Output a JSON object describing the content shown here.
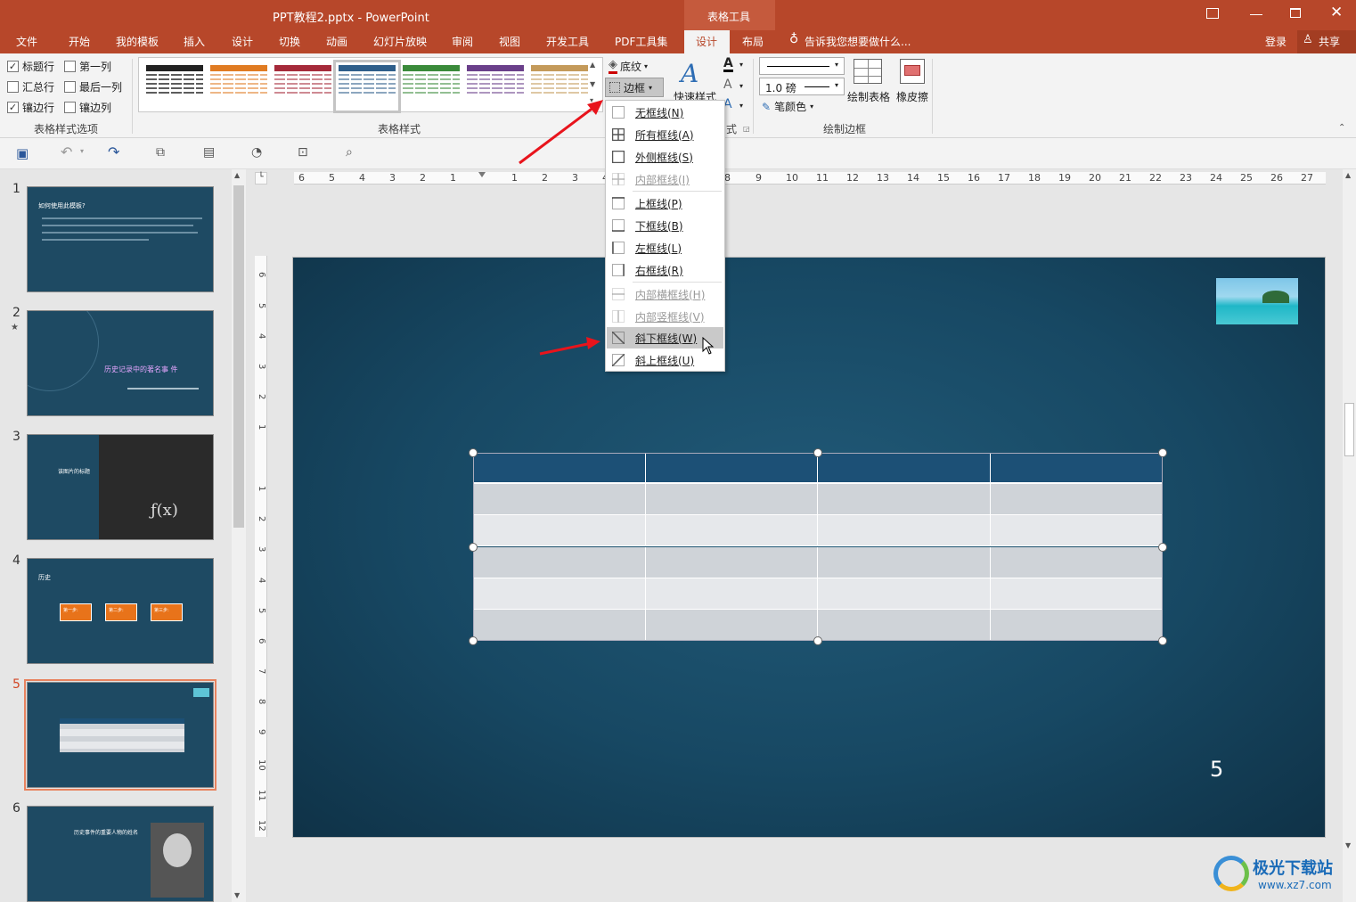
{
  "titlebar": {
    "title": "PPT教程2.pptx - PowerPoint",
    "context_tab": "表格工具",
    "buttons": [
      "restore-ribbon",
      "minimize",
      "maximize",
      "close"
    ]
  },
  "tabs": {
    "items": [
      "文件",
      "开始",
      "我的模板",
      "插入",
      "设计",
      "切换",
      "动画",
      "幻灯片放映",
      "审阅",
      "视图",
      "开发工具",
      "PDF工具集",
      "设计",
      "布局"
    ],
    "active": "设计",
    "tell_me": "告诉我您想要做什么...",
    "login": "登录",
    "share": "共享"
  },
  "ribbon": {
    "options": {
      "header_row": "标题行",
      "first_column": "第一列",
      "total_row": "汇总行",
      "last_column": "最后一列",
      "banded_rows": "镶边行",
      "banded_columns": "镶边列",
      "label": "表格样式选项",
      "checked": {
        "header_row": true,
        "first_column": false,
        "total_row": false,
        "last_column": false,
        "banded_rows": true,
        "banded_columns": false
      }
    },
    "styles": {
      "label": "表格样式",
      "colors": [
        "#222222",
        "#e07b22",
        "#a52a3a",
        "#2e5e8a",
        "#3a8a3a",
        "#6a3f8a",
        "#c49a5a"
      ],
      "selected_index": 3
    },
    "shading": "底纹",
    "border": "边框",
    "quick_styles": "快速样式",
    "wordart_label_fragment": "式",
    "draw": {
      "weight": "1.0 磅",
      "pen_color": "笔颜色",
      "draw_table": "绘制表格",
      "eraser": "橡皮擦",
      "label": "绘制边框"
    }
  },
  "border_menu": {
    "items": [
      {
        "label": "无框线(N)",
        "icon": "no-border",
        "disabled": false
      },
      {
        "label": "所有框线(A)",
        "icon": "all-borders",
        "disabled": false
      },
      {
        "label": "外侧框线(S)",
        "icon": "outside-borders",
        "disabled": false
      },
      {
        "label": "内部框线(I)",
        "icon": "inside-borders",
        "disabled": true
      },
      {
        "label": "上框线(P)",
        "icon": "top-border",
        "disabled": false
      },
      {
        "label": "下框线(B)",
        "icon": "bottom-border",
        "disabled": false
      },
      {
        "label": "左框线(L)",
        "icon": "left-border",
        "disabled": false
      },
      {
        "label": "右框线(R)",
        "icon": "right-border",
        "disabled": false
      },
      {
        "label": "内部横框线(H)",
        "icon": "inside-horizontal",
        "disabled": true
      },
      {
        "label": "内部竖框线(V)",
        "icon": "inside-vertical",
        "disabled": true
      },
      {
        "label": "斜下框线(W)",
        "icon": "diagonal-down",
        "disabled": false,
        "highlighted": true
      },
      {
        "label": "斜上框线(U)",
        "icon": "diagonal-up",
        "disabled": false
      }
    ]
  },
  "slides": {
    "active": 5,
    "thumbs": [
      {
        "num": "1",
        "title": "如何使用此模板?"
      },
      {
        "num": "2",
        "title": "历史记录中的著名事 件"
      },
      {
        "num": "3",
        "title": "该图片的标题"
      },
      {
        "num": "4",
        "title": "历史",
        "steps": [
          "第一步:",
          "第二步:",
          "第三步:"
        ]
      },
      {
        "num": "5"
      },
      {
        "num": "6",
        "title": "历史事件的重要人物的姓名"
      }
    ]
  },
  "ruler": {
    "h_ticks": [
      "6",
      "5",
      "4",
      "3",
      "2",
      "1",
      "1",
      "2",
      "3",
      "4",
      "8",
      "9",
      "10",
      "11",
      "12",
      "13",
      "14",
      "15",
      "16",
      "17",
      "18",
      "19",
      "20",
      "21",
      "22",
      "23",
      "24",
      "25",
      "26",
      "27"
    ],
    "v_ticks": [
      "6",
      "5",
      "4",
      "3",
      "2",
      "1",
      "1",
      "2",
      "3",
      "4",
      "5",
      "6",
      "7",
      "8",
      "9",
      "10",
      "11",
      "12"
    ]
  },
  "slide": {
    "page_number": "5",
    "table": {
      "rows": 6,
      "cols": 4,
      "header_color": "#1c5076",
      "band_dark": "#cfd3d8",
      "band_light": "#e6e8eb"
    }
  },
  "watermark": {
    "brand": "极光下载站",
    "url": "www.xz7.com"
  }
}
